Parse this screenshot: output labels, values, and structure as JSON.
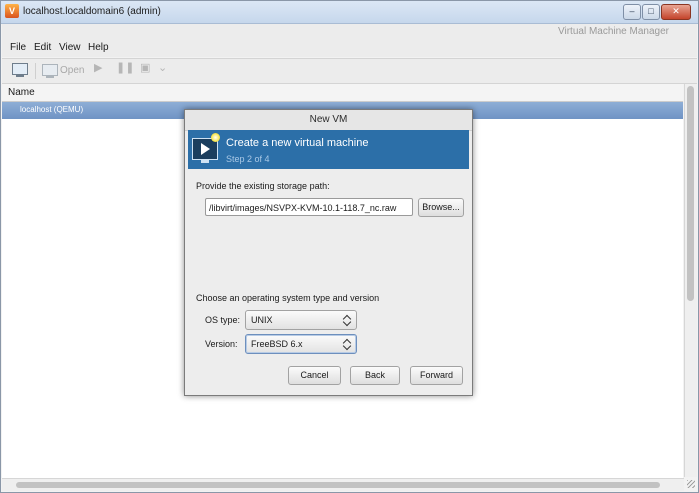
{
  "window": {
    "title": "localhost.localdomain6 (admin)",
    "app_name": "Virtual Machine Manager",
    "controls": {
      "minimize": "–",
      "maximize": "□",
      "close": "✕"
    }
  },
  "menubar": {
    "items": [
      "File",
      "Edit",
      "View",
      "Help"
    ]
  },
  "toolbar": {
    "open_label": "Open"
  },
  "table": {
    "column_header": "Name",
    "rows": [
      {
        "label": "localhost (QEMU)",
        "selected": true
      }
    ]
  },
  "dialog": {
    "title": "New VM",
    "banner": {
      "title": "Create a new virtual machine",
      "step": "Step 2 of 4"
    },
    "storage": {
      "label": "Provide the existing storage path:",
      "value": "/libvirt/images/NSVPX-KVM-10.1-118.7_nc.raw",
      "browse_label": "Browse..."
    },
    "os": {
      "section_label": "Choose an operating system type and version",
      "type_label": "OS type:",
      "type_value": "UNIX",
      "version_label": "Version:",
      "version_value": "FreeBSD 6.x"
    },
    "buttons": {
      "cancel": "Cancel",
      "back": "Back",
      "forward": "Forward"
    }
  },
  "colors": {
    "banner": "#2c6fa8",
    "selection": "#7a9ccb"
  }
}
